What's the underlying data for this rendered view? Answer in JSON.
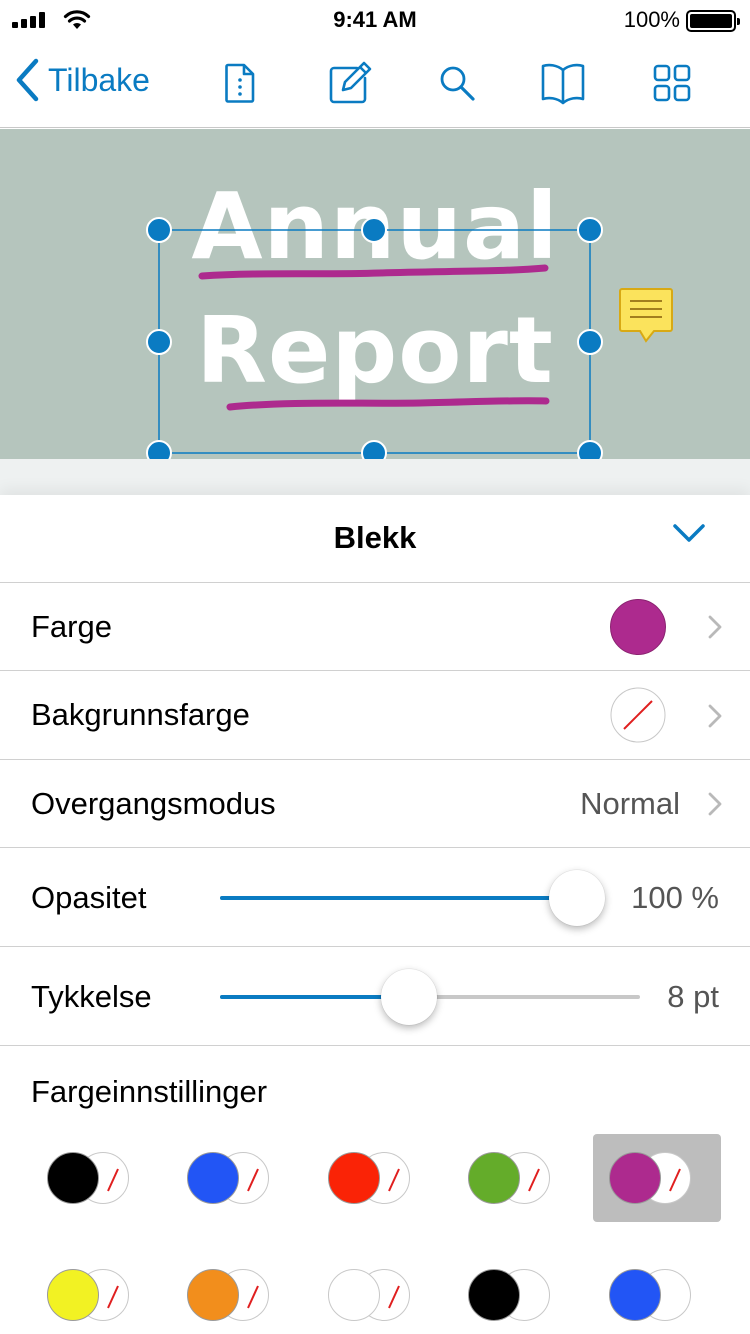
{
  "status_bar": {
    "time": "9:41 AM",
    "battery_percent": "100%"
  },
  "toolbar": {
    "back_label": "Tilbake"
  },
  "document": {
    "title_line1": "Annual",
    "title_line2": "Report"
  },
  "panel": {
    "title": "Blekk",
    "rows": {
      "color": {
        "label": "Farge",
        "value_color": "#ad2a8e"
      },
      "background": {
        "label": "Bakgrunnsfarge",
        "value": "none"
      },
      "blend": {
        "label": "Overgangsmodus",
        "value": "Normal"
      },
      "opacity": {
        "label": "Opasitet",
        "value": "100 %",
        "level": 1.0
      },
      "thickness": {
        "label": "Tykkelse",
        "value": "8 pt",
        "level": 0.45
      }
    },
    "presets_title": "Fargeinnstillinger",
    "presets": [
      {
        "color": "#000000",
        "background": "none",
        "selected": false
      },
      {
        "color": "#2255f5",
        "background": "none",
        "selected": false
      },
      {
        "color": "#fa2306",
        "background": "none",
        "selected": false
      },
      {
        "color": "#64ac2a",
        "background": "none",
        "selected": false
      },
      {
        "color": "#ad2a8e",
        "background": "none",
        "selected": true
      },
      {
        "color": "#f2f223",
        "background": "none",
        "selected": false
      },
      {
        "color": "#f28e1c",
        "background": "none",
        "selected": false
      },
      {
        "color": "#ffffff",
        "background": "none",
        "selected": false
      },
      {
        "color": "#000000",
        "background": "#ffffff",
        "selected": false
      },
      {
        "color": "#2255f5",
        "background": "#ffffff",
        "selected": false
      }
    ]
  },
  "colors": {
    "accent": "#0a7bc2",
    "ink": "#ad2a8e",
    "page_background": "#b5c5bd"
  },
  "icons": [
    "back-chevron-icon",
    "document-info-icon",
    "annotate-icon",
    "search-icon",
    "bookmarks-icon",
    "thumbnails-icon",
    "note-icon",
    "chevron-down-icon",
    "chevron-right-icon"
  ]
}
